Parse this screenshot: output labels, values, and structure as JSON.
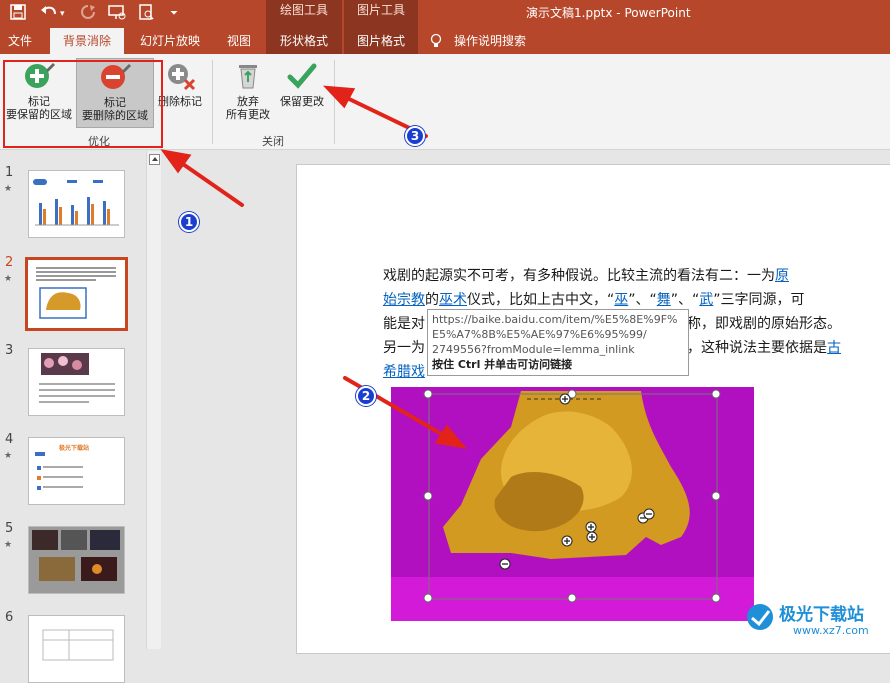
{
  "titlebar": {
    "doc_title": "演示文稿1.pptx  -  PowerPoint",
    "context_groups": [
      "绘图工具",
      "图片工具"
    ],
    "bg": "#b7472a"
  },
  "tabs": [
    "文件",
    "背景消除",
    "幻灯片放映",
    "视图",
    "形状格式",
    "图片格式",
    "操作说明搜索"
  ],
  "ribbon": {
    "mark_keep": [
      "标记",
      "要保留的区域"
    ],
    "mark_delete": [
      "标记",
      "要删除的区域"
    ],
    "delete_mark": "删除标记",
    "discard": [
      "放弃",
      "所有更改"
    ],
    "keep_changes": "保留更改",
    "group_optimize": "优化",
    "group_close": "关闭"
  },
  "slides": [
    {
      "num": "1",
      "star": "★"
    },
    {
      "num": "2",
      "star": "★"
    },
    {
      "num": "3",
      "star": ""
    },
    {
      "num": "4",
      "star": "★"
    },
    {
      "num": "5",
      "star": "★"
    },
    {
      "num": "6",
      "star": ""
    }
  ],
  "thumb4_title": "极光下载站",
  "slide_text": {
    "l1a": "戏剧的起源实不可考，有多种假说。比较主流的看法有二：一为",
    "l1link": "原",
    "l2link": "始宗教",
    "l2a": "的",
    "l2link2": "巫术",
    "l2b": "仪式，比如上古中文，“",
    "l2w1": "巫",
    "l2c": "”、“",
    "l2w2": "舞",
    "l2d": "”、“",
    "l2w3": "武",
    "l2e": "”三字同源，可",
    "l3a": "能是对",
    "l3b": "称，即戏剧的原始形态。",
    "l4a": "另一为",
    "l4b": "，这种说法主要依据是",
    "l4link": "古",
    "l5link": "希腊戏"
  },
  "tooltip": {
    "url1": "https://baike.baidu.com/item/%E5%8E%9F%",
    "url2": "E5%A7%8B%E5%AE%97%E6%95%99/",
    "url3": "2749556?fromModule=lemma_inlink",
    "hint": "按住 Ctrl 并单击可访问链接"
  },
  "callouts": [
    "1",
    "2",
    "3"
  ],
  "watermark": {
    "name": "极光下载站",
    "url": "www.xz7.com"
  },
  "colors": {
    "accent": "#b7472a",
    "annotation": "#e2231a",
    "removed_area": "#b010c0"
  }
}
